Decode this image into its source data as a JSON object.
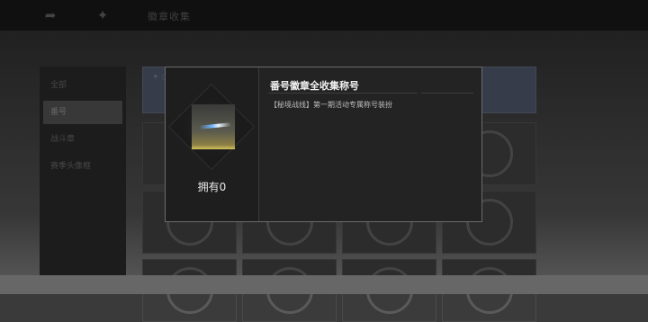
{
  "topbar": {
    "share_icon": "share-icon",
    "settings_icon": "gear-icon",
    "title": "徽章收集"
  },
  "sidebar": {
    "items": [
      {
        "label": "全部"
      },
      {
        "label": "番号"
      },
      {
        "label": "战斗章"
      },
      {
        "label": "赛季头像框"
      }
    ]
  },
  "dialog": {
    "item_title": "番号徽章全收集称号",
    "item_description": "【秘境战线】第一期活动专属称号装扮",
    "own_count_label": "拥有0"
  }
}
